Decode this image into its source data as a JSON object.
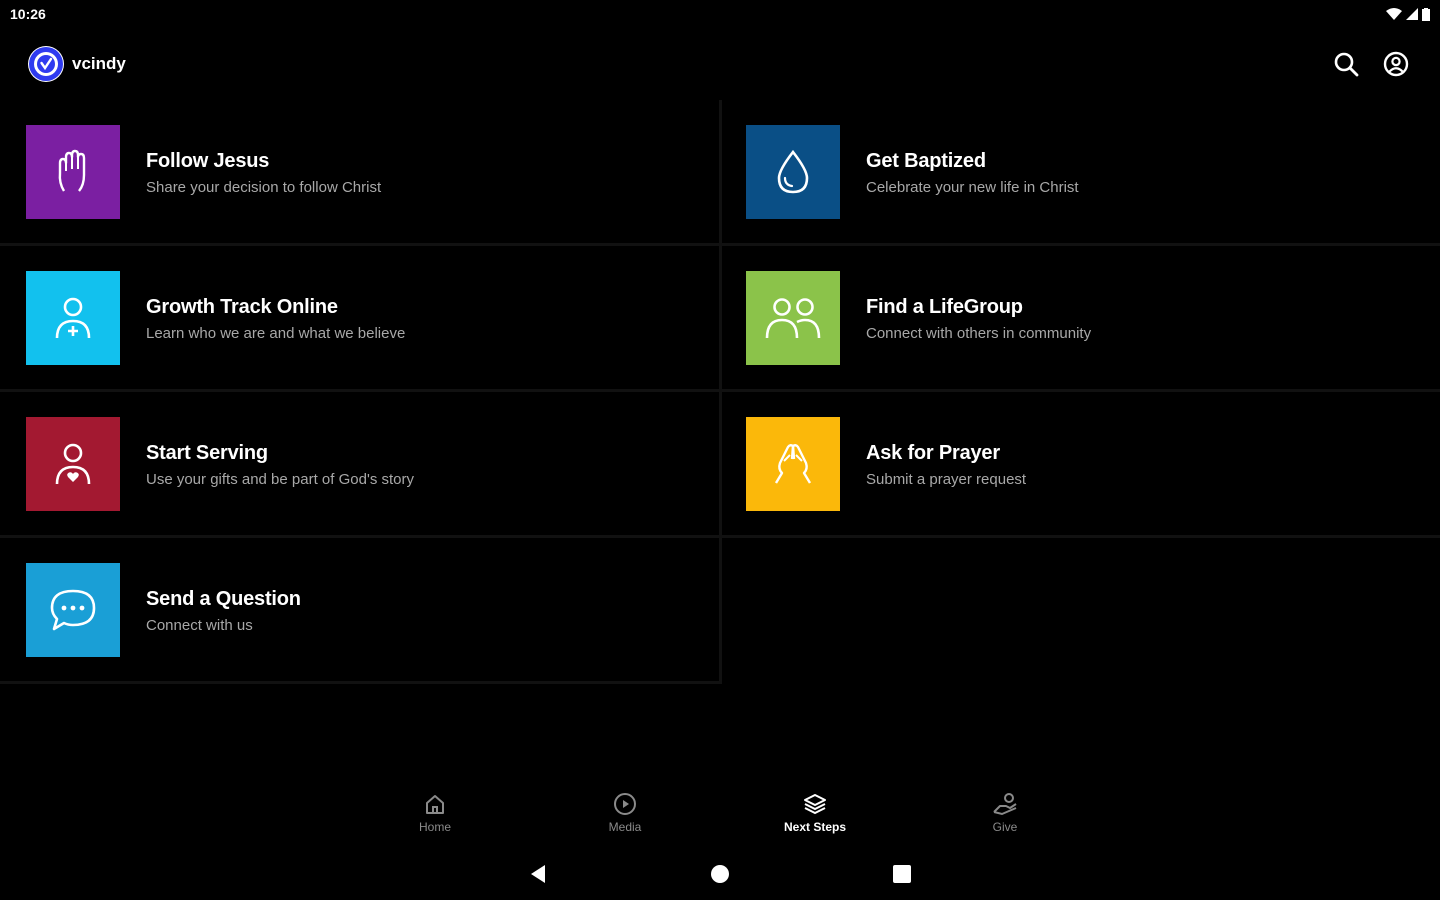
{
  "status_bar": {
    "time": "10:26"
  },
  "app": {
    "name": "vcindy",
    "brand_color": "#2f3bf0"
  },
  "header_actions": {
    "search_icon": "search-icon",
    "account_icon": "account-icon"
  },
  "items": [
    {
      "title": "Follow Jesus",
      "subtitle": "Share your decision to follow Christ",
      "color": "#7b1fa2",
      "icon": "raised-hand-icon"
    },
    {
      "title": "Get Baptized",
      "subtitle": "Celebrate your new life in Christ",
      "color": "#0a4f86",
      "icon": "water-drop-icon"
    },
    {
      "title": "Growth Track Online",
      "subtitle": "Learn who we are and what we believe",
      "color": "#12c1ee",
      "icon": "person-plus-icon"
    },
    {
      "title": "Find a LifeGroup",
      "subtitle": "Connect with others in community",
      "color": "#8bc34a",
      "icon": "people-icon"
    },
    {
      "title": "Start Serving",
      "subtitle": "Use your gifts and be part of God's story",
      "color": "#a31931",
      "icon": "person-heart-icon"
    },
    {
      "title": "Ask for Prayer",
      "subtitle": "Submit a prayer request",
      "color": "#fbb80a",
      "icon": "praying-hands-icon"
    },
    {
      "title": "Send a Question",
      "subtitle": "Connect with us",
      "color": "#1a9fd6",
      "icon": "chat-bubble-icon"
    }
  ],
  "bottom_nav": [
    {
      "label": "Home",
      "icon": "home-icon",
      "active": false
    },
    {
      "label": "Media",
      "icon": "play-circle-icon",
      "active": false
    },
    {
      "label": "Next Steps",
      "icon": "layers-icon",
      "active": true
    },
    {
      "label": "Give",
      "icon": "give-hand-icon",
      "active": false
    }
  ]
}
